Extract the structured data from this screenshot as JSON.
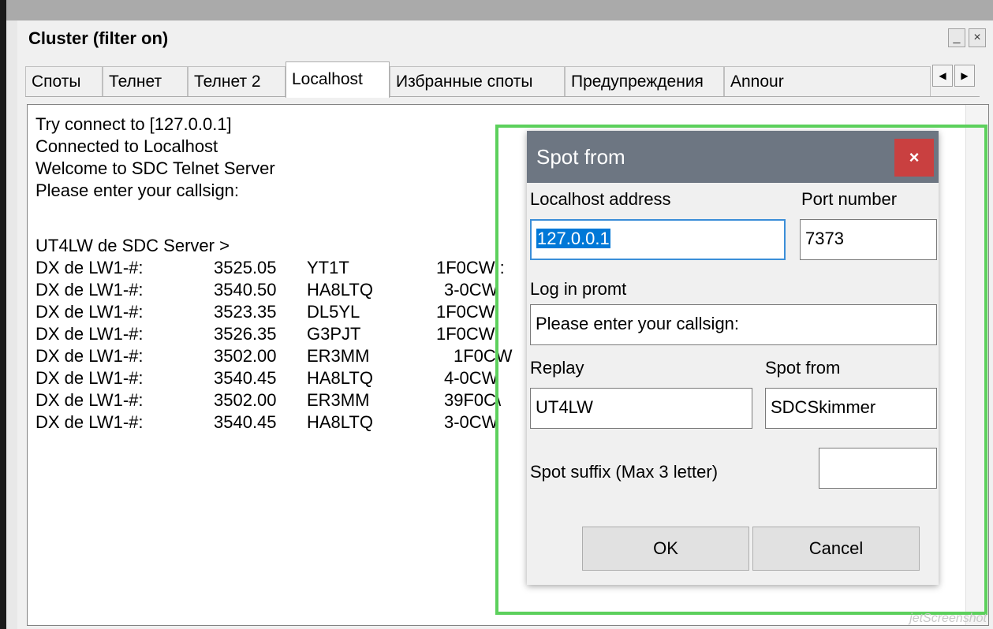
{
  "window": {
    "title": "Cluster (filter on)",
    "minimize_icon": "minimize-icon",
    "close_icon": "close-icon"
  },
  "tabs": [
    {
      "label": "Споты"
    },
    {
      "label": "Телнет"
    },
    {
      "label": "Телнет 2"
    },
    {
      "label": "Localhost"
    },
    {
      "label": "Избранные споты"
    },
    {
      "label": "Предупреждения"
    },
    {
      "label": "Annour"
    }
  ],
  "terminal": {
    "lines": [
      "Try connect to [127.0.0.1]",
      "Connected to Localhost",
      "Welcome to SDC Telnet Server",
      "Please enter your callsign:",
      "",
      "UT4LW de SDC Server >"
    ],
    "spots": [
      {
        "from": "DX de LW1-#:",
        "freq": "3525.05",
        "call": "YT1T",
        "info": "1F0CW :"
      },
      {
        "from": "DX de LW1-#:",
        "freq": "3540.50",
        "call": "HA8LTQ",
        "info": "3-0CW"
      },
      {
        "from": "DX de LW1-#:",
        "freq": "3523.35",
        "call": "DL5YL",
        "info": "1F0CW"
      },
      {
        "from": "DX de LW1-#:",
        "freq": "3526.35",
        "call": "G3PJT",
        "info": "1F0CW"
      },
      {
        "from": "DX de LW1-#:",
        "freq": "3502.00",
        "call": "ER3MM",
        "info": "1F0CW"
      },
      {
        "from": "DX de LW1-#:",
        "freq": "3540.45",
        "call": "HA8LTQ",
        "info": "4-0CW"
      },
      {
        "from": "DX de LW1-#:",
        "freq": "3502.00",
        "call": "ER3MM",
        "info": "39F0C\\"
      },
      {
        "from": "DX de LW1-#:",
        "freq": "3540.45",
        "call": "HA8LTQ",
        "info": "3-0CW"
      }
    ]
  },
  "dialog": {
    "title": "Spot from",
    "close_glyph": "×",
    "localhost_label": "Localhost address",
    "localhost_value": "127.0.0.1",
    "port_label": "Port number",
    "port_value": "7373",
    "login_label": "Log in promt",
    "login_value": "Please enter your callsign:",
    "replay_label": "Replay",
    "replay_value": "UT4LW",
    "spotfrom_label": "Spot from",
    "spotfrom_value": "SDCSkimmer",
    "suffix_label": "Spot suffix (Max 3 letter)",
    "suffix_value": "",
    "ok_label": "OK",
    "cancel_label": "Cancel"
  },
  "colors": {
    "highlight": "#5cd05c",
    "dialog_title": "#6d7682",
    "close_red": "#c94040"
  },
  "watermark": "jetScreenshot"
}
